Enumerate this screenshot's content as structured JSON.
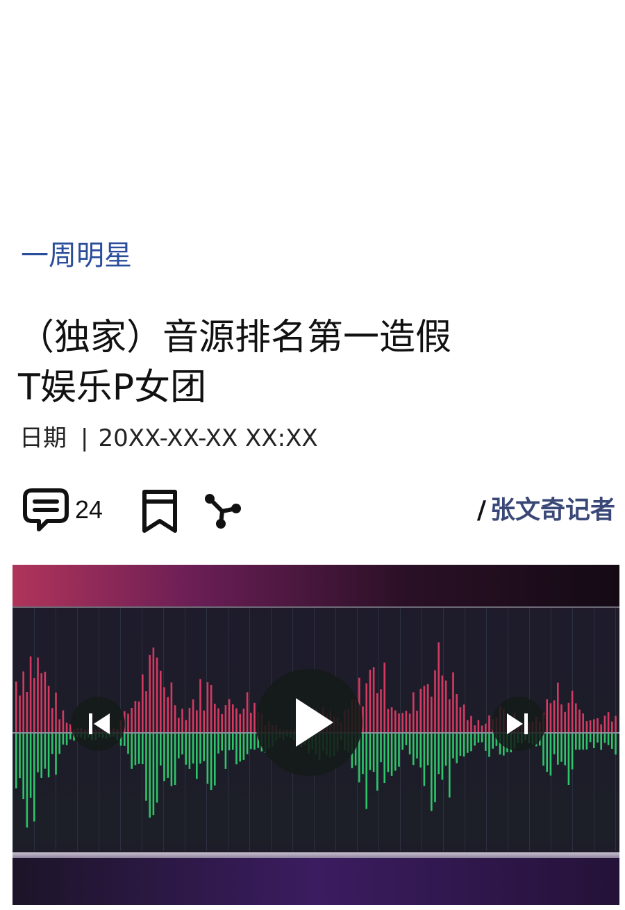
{
  "article": {
    "category": "一周明星",
    "title_line1": "（独家）音源排名第一造假",
    "title_line2": "T娱乐P女团",
    "date_label": "日期",
    "date_sep": "|",
    "date_value": "20XX-XX-XX XX:XX",
    "byline_slash": "/",
    "byline_author": "张文奇记者"
  },
  "actions": {
    "comment_count": "24",
    "icons": [
      "comment-icon",
      "bookmark-icon",
      "share-icon"
    ]
  },
  "player": {
    "controls": [
      "previous-icon",
      "play-icon",
      "next-icon"
    ],
    "colors": {
      "upper_bars": "#d33a62",
      "lower_bars": "#2ec46a",
      "grid": "#2b3040"
    }
  }
}
